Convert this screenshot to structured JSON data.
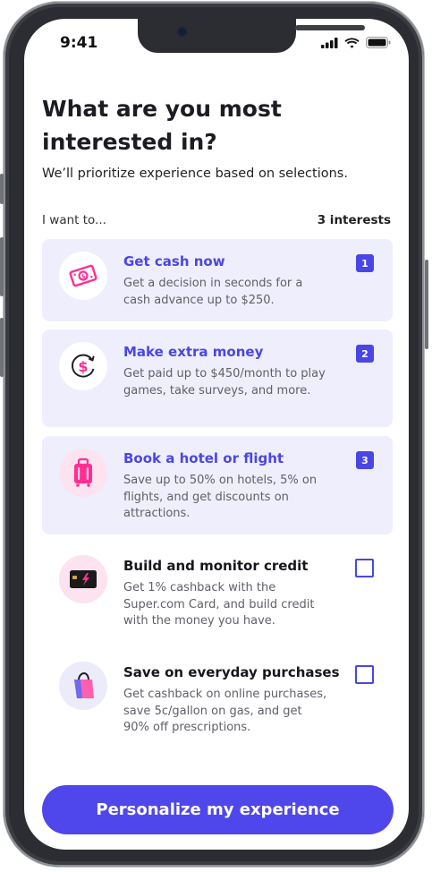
{
  "status_bar": {
    "time": "9:41"
  },
  "header": {
    "title": "What are you most interested in?",
    "subtitle": "We’ll prioritize experience based on selections."
  },
  "selection": {
    "label": "I want to...",
    "count": "3 interests"
  },
  "options": [
    {
      "title": "Get cash now",
      "description": "Get a decision in seconds for a cash advance up to $250.",
      "selected": true,
      "badge": "1",
      "icon": "cash-icon"
    },
    {
      "title": "Make extra money",
      "description": "Get paid up to $450/month to play games, take surveys, and more.",
      "selected": true,
      "badge": "2",
      "icon": "dollar-cycle-icon"
    },
    {
      "title": "Book a hotel or flight",
      "description": "Save up to 50% on hotels, 5% on flights, and get discounts on attractions.",
      "selected": true,
      "badge": "3",
      "icon": "luggage-icon"
    },
    {
      "title": "Build and monitor credit",
      "description": "Get 1% cashback with the Super.com Card, and build credit with the money you have.",
      "selected": false,
      "badge": "",
      "icon": "credit-card-icon"
    },
    {
      "title": "Save on everyday purchases",
      "description": "Get cashback on online purchases, save 5c/gallon on gas, and get 90% off prescriptions.",
      "selected": false,
      "badge": "",
      "icon": "shopping-bag-icon"
    }
  ],
  "cta": {
    "label": "Personalize my experience"
  },
  "colors": {
    "accent": "#4a46e6",
    "selected_bg": "#efeefc",
    "pink": "#ff2e93",
    "icon_bg_pink": "#fde3ef",
    "icon_bg_lavender": "#ecebfa"
  }
}
